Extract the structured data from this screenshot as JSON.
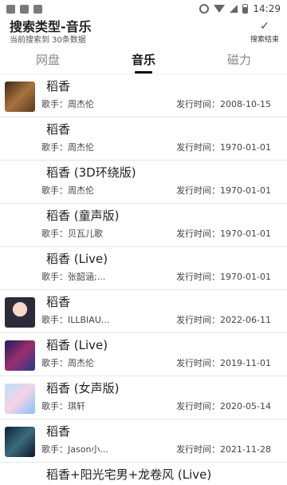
{
  "status": {
    "time": "14:29"
  },
  "header": {
    "title": "搜索类型-音乐",
    "subtitle": "当前搜索到 30条数据",
    "finish_label": "搜索结束",
    "finish_icon": "check-icon"
  },
  "tabs": [
    {
      "label": "网盘",
      "active": false
    },
    {
      "label": "音乐",
      "active": true
    },
    {
      "label": "磁力",
      "active": false
    }
  ],
  "results": [
    {
      "title": "稻香",
      "singer": "歌手：周杰伦",
      "date": "发行时间：2008-10-15",
      "has_cover": true
    },
    {
      "title": "稻香",
      "singer": "歌手：周杰伦",
      "date": "发行时间：1970-01-01",
      "has_cover": false
    },
    {
      "title": "稻香 (3D环绕版)",
      "singer": "歌手：周杰伦",
      "date": "发行时间：1970-01-01",
      "has_cover": false
    },
    {
      "title": "稻香 (童声版)",
      "singer": "歌手：贝瓦儿歌",
      "date": "发行时间：1970-01-01",
      "has_cover": false
    },
    {
      "title": "稻香 (Live)",
      "singer": "歌手：张韶涵;...",
      "date": "发行时间：1970-01-01",
      "has_cover": false
    },
    {
      "title": "稻香",
      "singer": "歌手：ILLBIAU...",
      "date": "发行时间：2022-06-11",
      "has_cover": true
    },
    {
      "title": "稻香 (Live)",
      "singer": "歌手：周杰伦",
      "date": "发行时间：2019-11-01",
      "has_cover": true
    },
    {
      "title": "稻香 (女声版)",
      "singer": "歌手：琪轩",
      "date": "发行时间：2020-05-14",
      "has_cover": true
    },
    {
      "title": "稻香",
      "singer": "歌手：Jason小...",
      "date": "发行时间：2021-11-28",
      "has_cover": true
    },
    {
      "title": "稻香+阳光宅男+龙卷风 (Live)"
    }
  ]
}
